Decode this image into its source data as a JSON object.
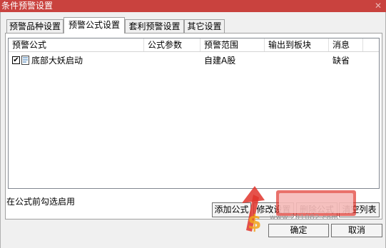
{
  "window": {
    "title": "条件预警设置"
  },
  "tabs": [
    {
      "label": "预警品种设置"
    },
    {
      "label": "预警公式设置"
    },
    {
      "label": "套利预警设置"
    },
    {
      "label": "其它设置"
    }
  ],
  "table": {
    "columns": [
      "预警公式",
      "公式参数",
      "预警范围",
      "输出到板块",
      "消息"
    ],
    "rows": [
      {
        "checked": true,
        "formula": "底部大妖启动",
        "params": "",
        "range": "自建A股",
        "output": "",
        "message": "缺省"
      }
    ]
  },
  "status_text": "在公式前勾选启用",
  "buttons": {
    "add": "添加公式",
    "modify": "修改设置",
    "delete": "删除公式",
    "clear": "清空列表",
    "ok": "确定",
    "cancel": "取消"
  },
  "watermark": {
    "text": "www.201082.com"
  },
  "colors": {
    "titlebar": "#c9423e"
  }
}
